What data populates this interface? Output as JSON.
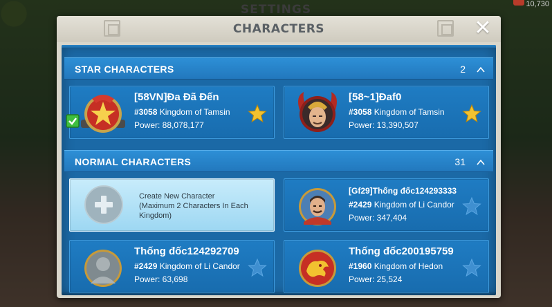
{
  "background": {
    "settings_title": "SETTINGS",
    "resource_counter": "10,730"
  },
  "dialog": {
    "title": "CHARACTERS",
    "close_glyph": "✕"
  },
  "sections": {
    "star": {
      "title": "STAR CHARACTERS",
      "count": "2",
      "characters": [
        {
          "name": "[58VN]Đa Đã Đến",
          "kingdom_id": "#3058",
          "kingdom_name": "Kingdom of Tamsin",
          "power": "Power: 88,078,177",
          "starred": true,
          "current": true,
          "avatar": "red-star-emblem-avatar"
        },
        {
          "name": "[58~1]Đaf0",
          "kingdom_id": "#3058",
          "kingdom_name": "Kingdom of Tamsin",
          "power": "Power: 13,390,507",
          "starred": true,
          "current": false,
          "avatar": "horned-warrior-portrait-avatar"
        }
      ]
    },
    "normal": {
      "title": "NORMAL CHARACTERS",
      "count": "31",
      "create_new": {
        "line1": "Create New Character",
        "line2": "(Maximum 2 Characters In Each",
        "line3": "Kingdom)"
      },
      "characters": [
        {
          "name": "[Gf29]Thống đốc124293333",
          "kingdom_id": "#2429",
          "kingdom_name": "Kingdom of Li Candor",
          "power": "Power: 347,404",
          "starred": false,
          "avatar": "governor-portrait-avatar"
        },
        {
          "name": "Thống đốc124292709",
          "kingdom_id": "#2429",
          "kingdom_name": "Kingdom of Li Candor",
          "power": "Power: 63,698",
          "starred": false,
          "avatar": "silhouette-avatar"
        },
        {
          "name": "Thống đốc200195759",
          "kingdom_id": "#1960",
          "kingdom_name": "Kingdom of Hedon",
          "power": "Power: 25,524",
          "starred": false,
          "avatar": "golden-dragon-emblem-avatar"
        }
      ]
    }
  },
  "colors": {
    "star_active": "#f2c230",
    "star_inactive": "#3f8fd0",
    "panel_blue": "#1b69a6",
    "check_green": "#3fbf3f"
  }
}
